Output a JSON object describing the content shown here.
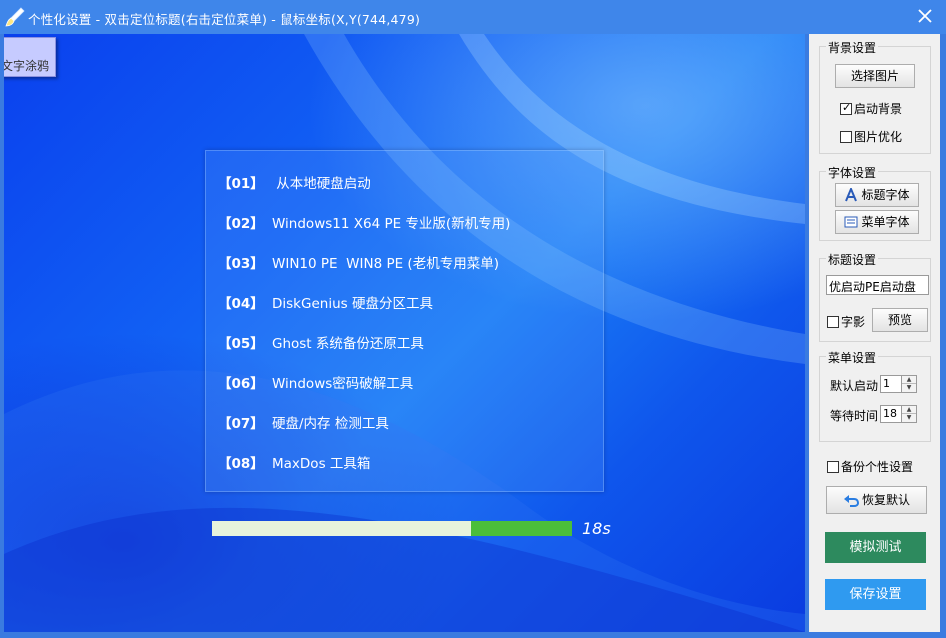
{
  "window": {
    "title": "个性化设置 - 双击定位标题(右击定位菜单) - 鼠标坐标(X,Y(744,479)",
    "icons": {
      "app": "brush-icon",
      "close": "close-icon"
    }
  },
  "preview": {
    "doodle_tab_label": "文字涂鸦",
    "menu_items": [
      {
        "num": "【01】",
        "label": " 从本地硬盘启动"
      },
      {
        "num": "【02】",
        "label": "Windows11 X64 PE 专业版(新机专用)"
      },
      {
        "num": "【03】",
        "label": "WIN10 PE  WIN8 PE (老机专用菜单)"
      },
      {
        "num": "【04】",
        "label": "DiskGenius 硬盘分区工具"
      },
      {
        "num": "【05】",
        "label": "Ghost 系统备份还原工具"
      },
      {
        "num": "【06】",
        "label": "Windows密码破解工具"
      },
      {
        "num": "【07】",
        "label": "硬盘/内存 检测工具"
      },
      {
        "num": "【08】",
        "label": "MaxDos 工具箱"
      }
    ],
    "progress": {
      "remaining_fraction": 0.28,
      "countdown": "18s"
    }
  },
  "panel": {
    "background": {
      "title": "背景设置",
      "choose_image": "选择图片",
      "enable_bg": {
        "label": "启动背景",
        "checked": true
      },
      "image_opt": {
        "label": "图片优化",
        "checked": false
      }
    },
    "font": {
      "title": "字体设置",
      "title_font": "标题字体",
      "menu_font": "菜单字体",
      "icons": {
        "title_font": "font-a-icon",
        "menu_font": "menu-list-icon"
      }
    },
    "title_settings": {
      "title": "标题设置",
      "value": "优启动PE启动盘",
      "shadow": {
        "label": "字影",
        "checked": false
      },
      "preview": "预览"
    },
    "menu_settings": {
      "title": "菜单设置",
      "default_boot_label": "默认启动",
      "default_boot_value": "1",
      "wait_label": "等待时间",
      "wait_value": "18"
    },
    "backup": {
      "label": "备份个性设置",
      "checked": false
    },
    "restore": {
      "label": "恢复默认",
      "icon": "undo-arrow-icon"
    },
    "simulate": {
      "label": "模拟测试",
      "color": "#2d8a5e"
    },
    "save": {
      "label": "保存设置",
      "color": "#2f9af0"
    }
  }
}
